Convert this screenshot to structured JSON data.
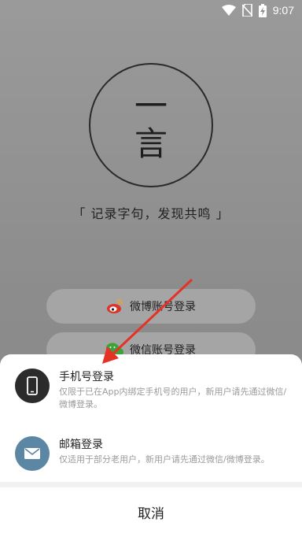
{
  "status_bar": {
    "time": "9:07",
    "icons": [
      "wifi-icon",
      "no-sim-icon",
      "battery-charging-icon"
    ]
  },
  "logo": {
    "line1": "一",
    "line2": "言"
  },
  "slogan": "「 记录字句，发现共鸣 」",
  "social_logins": [
    {
      "label": "微博账号登录",
      "icon": "weibo-icon",
      "color": "#d9352b"
    },
    {
      "label": "微信账号登录",
      "icon": "wechat-icon",
      "color": "#3ca33c"
    }
  ],
  "sheet": {
    "options": [
      {
        "title": "手机号登录",
        "desc": "仅限于已在App内绑定手机号的用户，新用户请先通过微信/微博登录。",
        "icon": "phone-icon"
      },
      {
        "title": "邮箱登录",
        "desc": "仅适用于部分老用户，新用户请先通过微信/微博登录。",
        "icon": "mail-icon"
      }
    ],
    "cancel": "取消"
  },
  "colors": {
    "accent_arrow": "#e53226",
    "mail_icon_bg": "#5b86a4",
    "phone_icon_bg": "#2b2b2b"
  }
}
